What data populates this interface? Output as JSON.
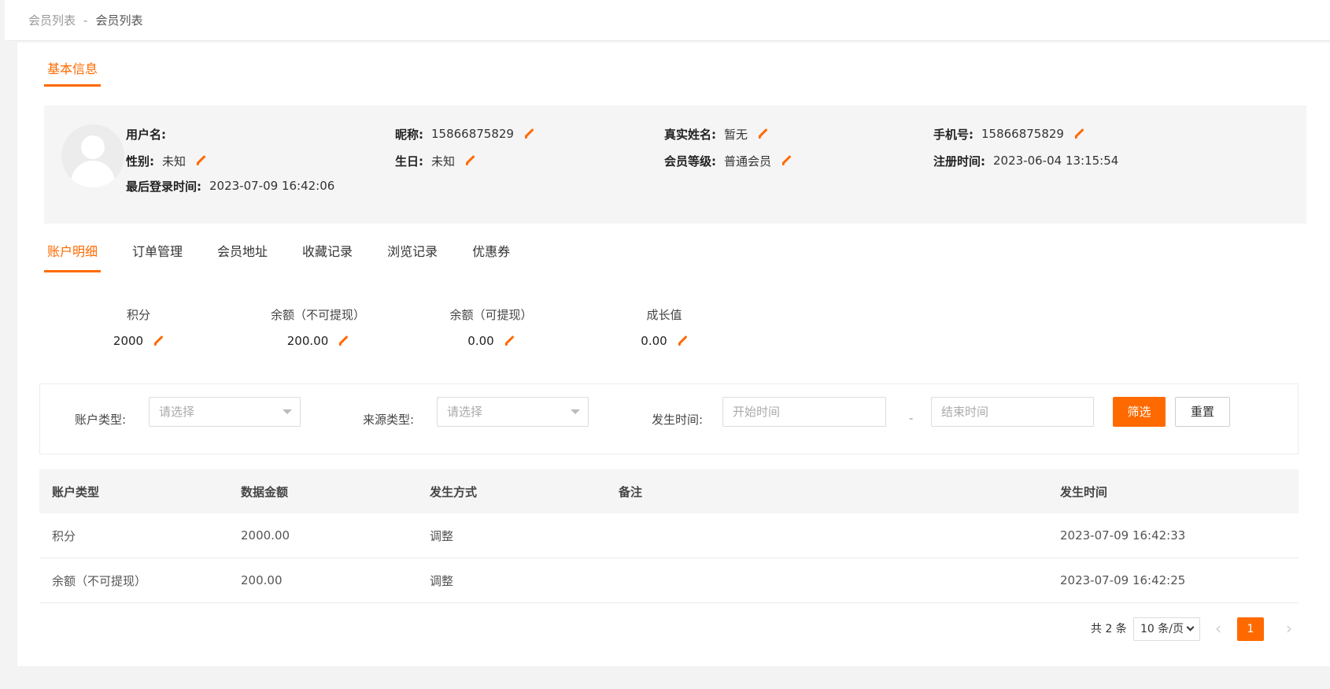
{
  "breadcrumb": {
    "parent": "会员列表",
    "separator": "-",
    "current": "会员列表"
  },
  "section_tab": "基本信息",
  "profile": {
    "username_label": "用户名:",
    "username_value": "",
    "nickname_label": "昵称:",
    "nickname_value": "15866875829",
    "realname_label": "真实姓名:",
    "realname_value": "暂无",
    "phone_label": "手机号:",
    "phone_value": "15866875829",
    "gender_label": "性别:",
    "gender_value": "未知",
    "birthday_label": "生日:",
    "birthday_value": "未知",
    "level_label": "会员等级:",
    "level_value": "普通会员",
    "regtime_label": "注册时间:",
    "regtime_value": "2023-06-04 13:15:54",
    "lastlogin_label": "最后登录时间:",
    "lastlogin_value": "2023-07-09 16:42:06"
  },
  "tabs": [
    "账户明细",
    "订单管理",
    "会员地址",
    "收藏记录",
    "浏览记录",
    "优惠券"
  ],
  "active_tab": "账户明细",
  "stats": [
    {
      "label": "积分",
      "value": "2000"
    },
    {
      "label": "余额（不可提现）",
      "value": "200.00"
    },
    {
      "label": "余额（可提现）",
      "value": "0.00"
    },
    {
      "label": "成长值",
      "value": "0.00"
    }
  ],
  "filter": {
    "account_type_label": "账户类型:",
    "account_type_placeholder": "请选择",
    "source_type_label": "来源类型:",
    "source_type_placeholder": "请选择",
    "time_label": "发生时间:",
    "start_placeholder": "开始时间",
    "dash": "-",
    "end_placeholder": "结束时间",
    "filter_button": "筛选",
    "reset_button": "重置"
  },
  "table": {
    "headers": [
      "账户类型",
      "数据金额",
      "发生方式",
      "备注",
      "发生时间"
    ],
    "rows": [
      [
        "积分",
        "2000.00",
        "调整",
        "",
        "2023-07-09 16:42:33"
      ],
      [
        "余额（不可提现）",
        "200.00",
        "调整",
        "",
        "2023-07-09 16:42:25"
      ]
    ]
  },
  "pagination": {
    "total": "共 2 条",
    "page_size": "10 条/页",
    "current_page": "1"
  },
  "colors": {
    "accent": "#ff6a00",
    "panel_bg": "#f5f5f5"
  },
  "icons": [
    "edit-pencil-icon",
    "avatar-icon",
    "chevron-down-icon",
    "chevron-left-icon",
    "chevron-right-icon"
  ]
}
